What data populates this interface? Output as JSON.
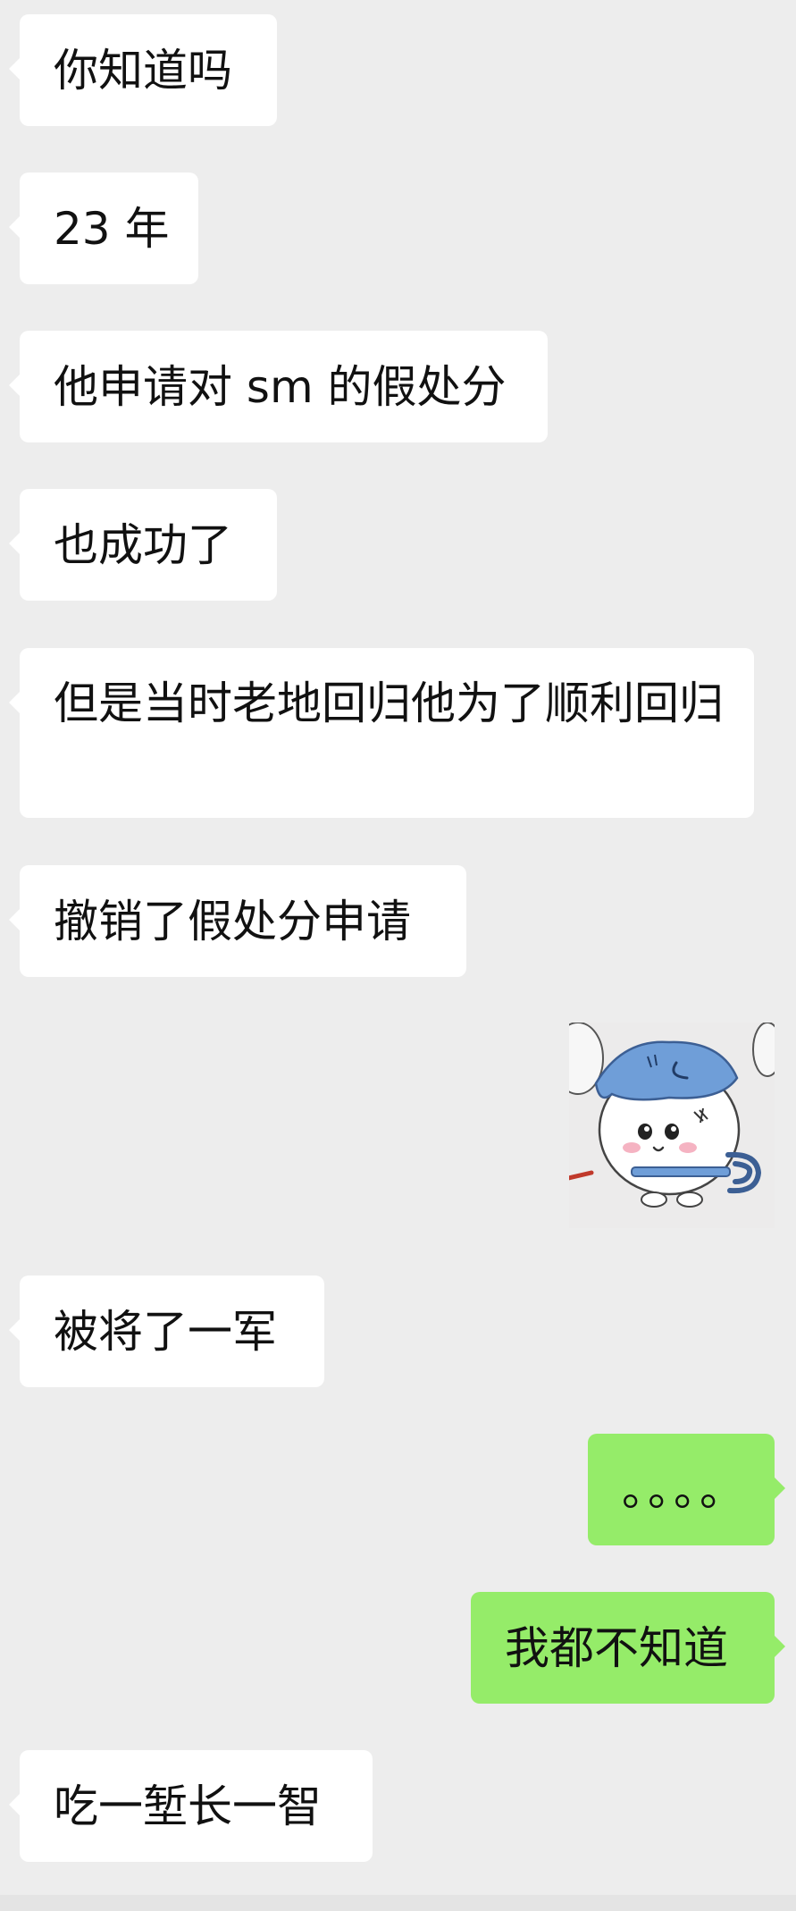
{
  "messages": [
    {
      "side": "in",
      "text": "你知道吗"
    },
    {
      "side": "in",
      "text": "23 年"
    },
    {
      "side": "in",
      "text": "他申请对 sm 的假处分"
    },
    {
      "side": "in",
      "text": "也成功了"
    },
    {
      "side": "in",
      "text": "但是当时老地回归他为了顺利回归"
    },
    {
      "side": "in",
      "text": "撤销了假处分申请"
    },
    {
      "side": "out",
      "type": "sticker",
      "icon": "hamster-character-sticker"
    },
    {
      "side": "in",
      "text": "被将了一军"
    },
    {
      "side": "out",
      "text": "。。。。"
    },
    {
      "side": "out",
      "text": "我都不知道"
    },
    {
      "side": "in",
      "text": "吃一堑长一智"
    }
  ],
  "colors": {
    "background": "#ededed",
    "incoming_bubble": "#ffffff",
    "outgoing_bubble": "#95ec69",
    "text": "#111111"
  }
}
